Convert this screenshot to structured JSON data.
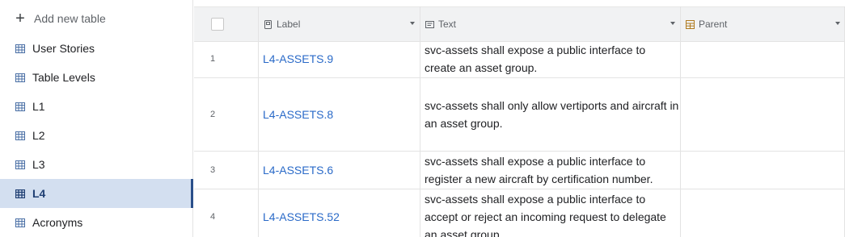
{
  "sidebar": {
    "add_new_table": "Add new table",
    "items": [
      {
        "label": "User Stories",
        "active": false
      },
      {
        "label": "Table Levels",
        "active": false
      },
      {
        "label": "L1",
        "active": false
      },
      {
        "label": "L2",
        "active": false
      },
      {
        "label": "L3",
        "active": false
      },
      {
        "label": "L4",
        "active": true
      },
      {
        "label": "Acronyms",
        "active": false
      }
    ]
  },
  "grid": {
    "columns": {
      "label": "Label",
      "text": "Text",
      "parent": "Parent"
    },
    "rows": [
      {
        "num": "1",
        "label": "L4-ASSETS.9",
        "text": "svc-assets shall expose a public interface to create an asset group.",
        "parent": ""
      },
      {
        "num": "2",
        "label": "L4-ASSETS.8",
        "text": "svc-assets shall only allow vertiports and aircraft in an asset group.",
        "parent": ""
      },
      {
        "num": "3",
        "label": "L4-ASSETS.6",
        "text": "svc-assets shall expose a public interface to register a new aircraft by certification number.",
        "parent": ""
      },
      {
        "num": "4",
        "label": "L4-ASSETS.52",
        "text": "svc-assets shall expose a public interface to accept or reject an incoming request to delegate an asset group.",
        "parent": ""
      }
    ]
  },
  "colors": {
    "accent": "#2a4f8a",
    "active_bg": "#d3dff0",
    "link": "#2a6ac8",
    "parent_icon": "#b07a1e"
  }
}
